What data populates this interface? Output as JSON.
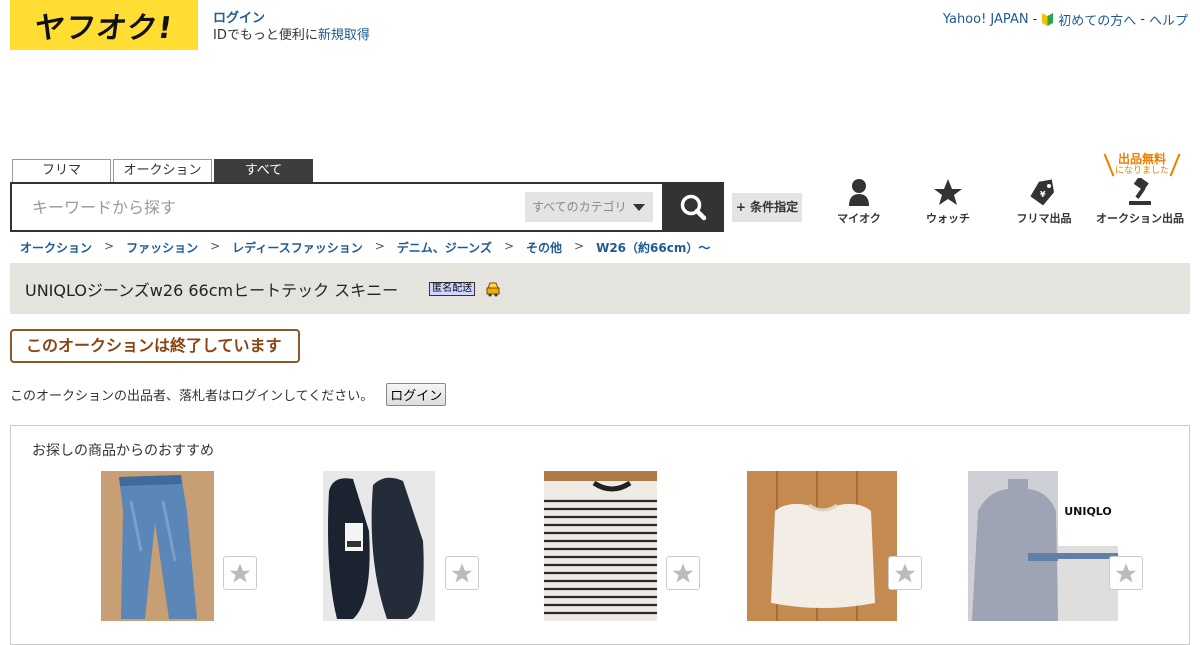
{
  "header": {
    "logo_text": "ヤフオク!",
    "login_link": "ログイン",
    "login_promo": "IDでもっと便利に",
    "signup_link": "新規取得",
    "links": [
      "Yahoo! JAPAN",
      "初めての方へ",
      "ヘルプ"
    ],
    "separator": "-"
  },
  "search": {
    "tabs": [
      "フリマ",
      "オークション",
      "すべて"
    ],
    "active_tab": "すべて",
    "placeholder": "キーワードから探す",
    "category": "すべてのカテゴリ",
    "condition_button": "+ 条件指定"
  },
  "quick_nav": {
    "items": [
      {
        "label": "マイオク",
        "icon": "person-icon"
      },
      {
        "label": "ウォッチ",
        "icon": "star-icon"
      },
      {
        "label": "フリマ出品",
        "icon": "price-tag-icon"
      },
      {
        "label": "オークション出品",
        "icon": "gavel-icon"
      }
    ],
    "free_badge_main": "出品無料",
    "free_badge_sub": "になりました"
  },
  "breadcrumb": [
    "オークション",
    "ファッション",
    "レディースファッション",
    "デニム、ジーンズ",
    "その他",
    "W26（約66cm）～"
  ],
  "breadcrumb_sep": ">",
  "item": {
    "title": "UNIQLOジーンズw26 66cmヒートテック スキニー",
    "badge": "匿名配送"
  },
  "status": {
    "ended": "このオークションは終了しています",
    "login_prompt": "このオークションの出品者、落札者はログインしてください。",
    "login_button": "ログイン"
  },
  "recommendations": {
    "title": "お探しの商品からのおすすめ",
    "items": [
      {
        "image": "jeans-photo"
      },
      {
        "image": "navy-flat-shoes-photo"
      },
      {
        "image": "striped-top-photo"
      },
      {
        "image": "white-knit-sweater-photo"
      },
      {
        "image": "gray-turtleneck-uniqlo-photo",
        "overlay_text": "UNIQLO"
      }
    ]
  },
  "colors": {
    "brand_yellow": "#ffdd33",
    "link_blue": "#1e5a96",
    "ended_brown": "#8b4513",
    "free_orange": "#ef7d00"
  }
}
